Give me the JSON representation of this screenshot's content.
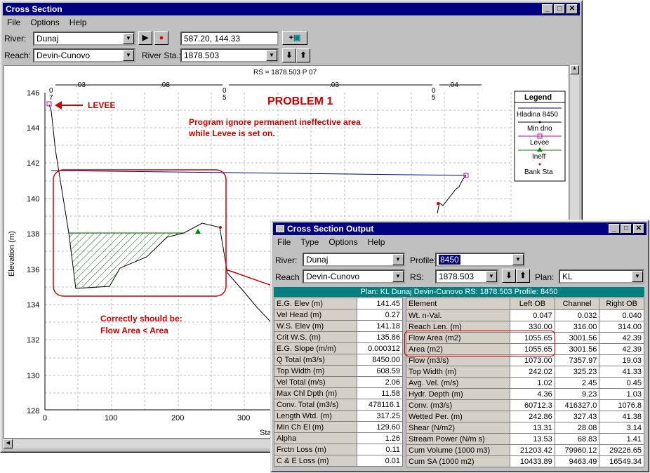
{
  "main_window": {
    "title": "Cross Section",
    "menu": [
      "File",
      "Options",
      "Help"
    ],
    "river_label": "River:",
    "river_value": "Dunaj",
    "coords": "587.20, 144.33",
    "reach_label": "Reach:",
    "reach_value": "Devin-Cunovo",
    "river_sta_label": "River Sta.:",
    "river_sta_value": "1878.503",
    "plus_btn": "+",
    "camera_icon": "camera-icon"
  },
  "plot": {
    "title": "RS = 1878.503  P 07",
    "ylabel": "Elevation (m)",
    "xlabel": "Sta",
    "y_ticks": [
      "146",
      "144",
      "142",
      "140",
      "138",
      "136",
      "134",
      "132",
      "130",
      "128"
    ],
    "x_ticks": [
      "0",
      "100",
      "200",
      "300"
    ],
    "n_values": [
      ".03",
      ".08",
      ".03",
      ".04"
    ],
    "n_markers": [
      [
        "0",
        "7"
      ],
      [
        "0",
        "5"
      ],
      [
        "0",
        "5"
      ]
    ],
    "annotations": {
      "problem": "PROBLEM 1",
      "problem_desc_1": "Program ignore permanent ineffective area",
      "problem_desc_2": "while Levee is set on.",
      "levee": "LEVEE",
      "correct_1": "Correctly should be:",
      "correct_2": "Flow Area < Area"
    },
    "legend": {
      "title": "Legend",
      "items": [
        "Hladina 8450",
        "Min dno",
        "Levee",
        "Ineff",
        "Bank Sta"
      ]
    },
    "colors": {
      "annotation": "#cc0000",
      "water": "#000080",
      "levee": "#cc00cc",
      "ineff": "#008000",
      "hatch": "#006600"
    }
  },
  "output_window": {
    "title": "Cross Section Output",
    "menu": [
      "File",
      "Type",
      "Options",
      "Help"
    ],
    "river_label": "River:",
    "river_value": "Dunaj",
    "profile_label": "Profile:",
    "profile_value": "8450",
    "reach_label": "Reach",
    "reach_value": "Devin-Cunovo",
    "rs_label": "RS:",
    "rs_value": "1878.503",
    "plan_label": "Plan:",
    "plan_value": "KL",
    "header_line": "Plan: KL    Dunaj    Devin-Cunovo  RS: 1878.503    Profile: 8450",
    "left_table": [
      [
        "E.G. Elev (m)",
        "141.45"
      ],
      [
        "Vel Head (m)",
        "0.27"
      ],
      [
        "W.S. Elev (m)",
        "141.18"
      ],
      [
        "Crit W.S. (m)",
        "135.86"
      ],
      [
        "E.G. Slope (m/m)",
        "0.000312"
      ],
      [
        "Q Total (m3/s)",
        "8450.00"
      ],
      [
        "Top Width (m)",
        "608.59"
      ],
      [
        "Vel Total (m/s)",
        "2.06"
      ],
      [
        "Max Chl Dpth (m)",
        "11.58"
      ],
      [
        "Conv. Total (m3/s)",
        "478116.1"
      ],
      [
        "Length Wtd. (m)",
        "317.25"
      ],
      [
        "Min Ch El (m)",
        "129.60"
      ],
      [
        "Alpha",
        "1.26"
      ],
      [
        "Frctn Loss (m)",
        "0.11"
      ],
      [
        "C & E Loss (m)",
        "0.01"
      ]
    ],
    "right_headers": [
      "Element",
      "Left OB",
      "Channel",
      "Right OB"
    ],
    "right_table": [
      [
        "Wt. n-Val.",
        "0.047",
        "0.032",
        "0.040"
      ],
      [
        "Reach Len. (m)",
        "330.00",
        "316.00",
        "314.00"
      ],
      [
        "Flow Area (m2)",
        "1055.65",
        "3001.56",
        "42.39"
      ],
      [
        "Area (m2)",
        "1055.65",
        "3001.56",
        "42.39"
      ],
      [
        "Flow (m3/s)",
        "1073.00",
        "7357.97",
        "19.03"
      ],
      [
        "Top Width (m)",
        "242.02",
        "325.23",
        "41.33"
      ],
      [
        "Avg. Vel. (m/s)",
        "1.02",
        "2.45",
        "0.45"
      ],
      [
        "Hydr. Depth (m)",
        "4.36",
        "9.23",
        "1.03"
      ],
      [
        "Conv. (m3/s)",
        "60712.3",
        "416327.0",
        "1076.8"
      ],
      [
        "Wetted Per. (m)",
        "242.86",
        "327.43",
        "41.38"
      ],
      [
        "Shear (N/m2)",
        "13.31",
        "28.08",
        "3.14"
      ],
      [
        "Stream Power (N/m s)",
        "13.53",
        "68.83",
        "1.41"
      ],
      [
        "Cum Volume (1000 m3)",
        "21203.42",
        "79960.12",
        "29226.65"
      ],
      [
        "Cum SA (1000 m2)",
        "10433.89",
        "9463.49",
        "16549.34"
      ]
    ]
  }
}
